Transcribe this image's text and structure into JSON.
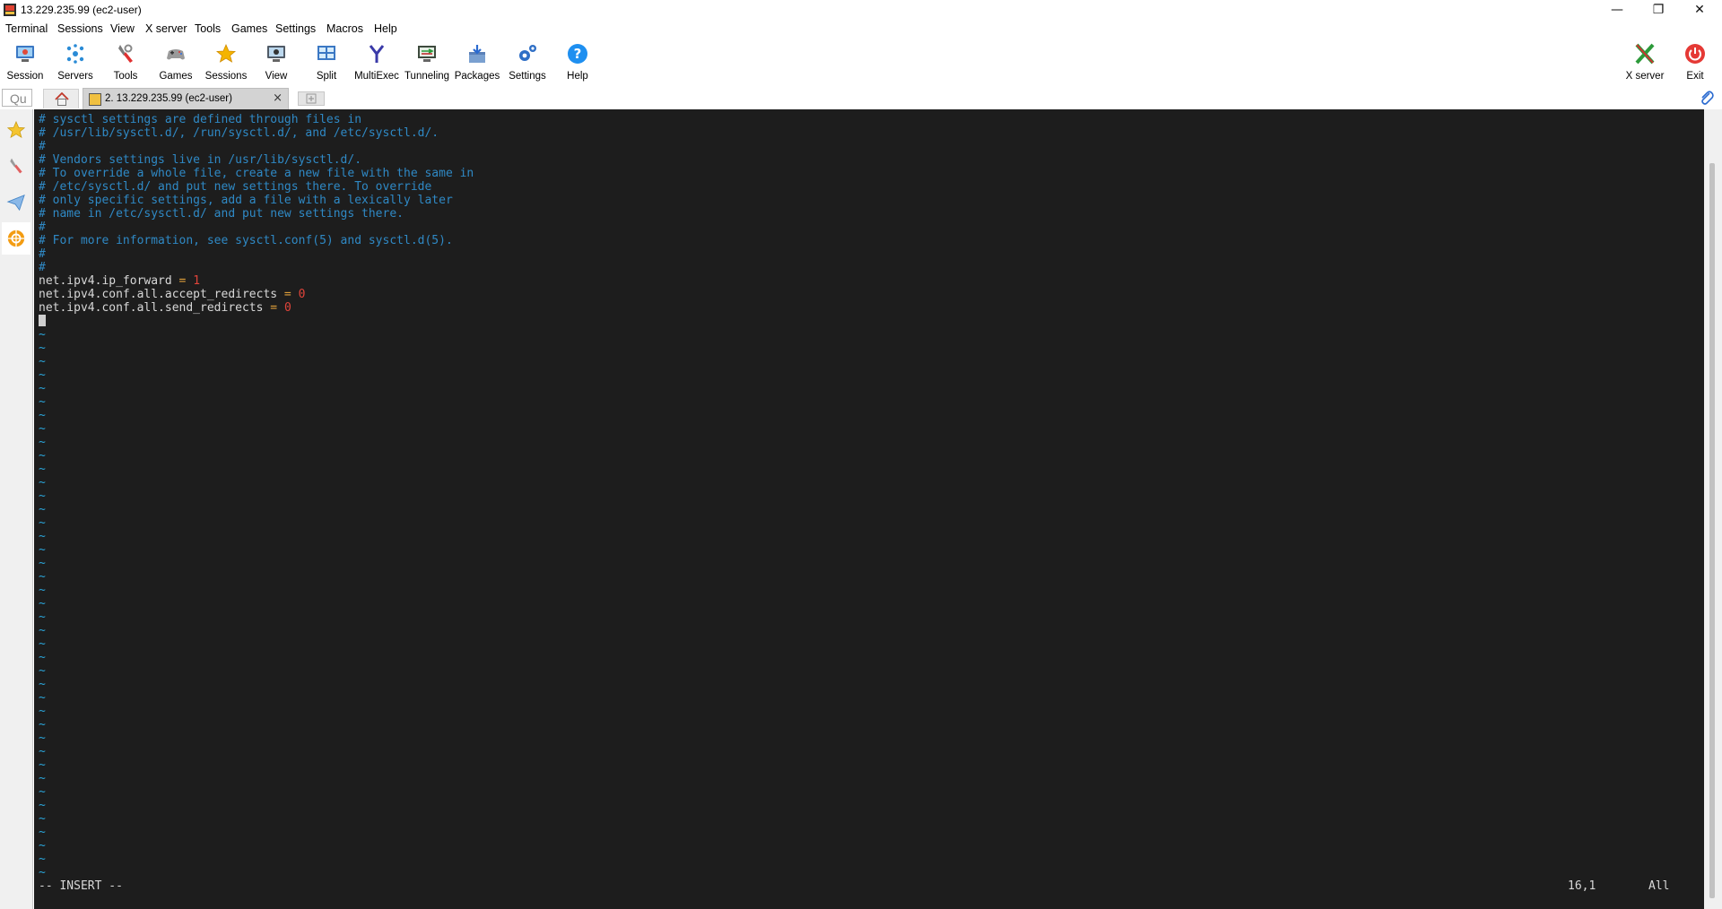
{
  "window": {
    "title": "13.229.235.99 (ec2-user)",
    "minimize_glyph": "—",
    "restore_glyph": "❐",
    "close_glyph": "✕"
  },
  "menu": [
    "Terminal",
    "Sessions",
    "View",
    "X server",
    "Tools",
    "Games",
    "Settings",
    "Macros",
    "Help"
  ],
  "toolbar": {
    "buttons": [
      {
        "label": "Session",
        "icon": "session-icon"
      },
      {
        "label": "Servers",
        "icon": "servers-icon"
      },
      {
        "label": "Tools",
        "icon": "tools-icon"
      },
      {
        "label": "Games",
        "icon": "games-icon"
      },
      {
        "label": "Sessions",
        "icon": "star-icon"
      },
      {
        "label": "View",
        "icon": "view-icon"
      },
      {
        "label": "Split",
        "icon": "split-icon"
      },
      {
        "label": "MultiExec",
        "icon": "multiexec-icon"
      },
      {
        "label": "Tunneling",
        "icon": "tunneling-icon"
      },
      {
        "label": "Packages",
        "icon": "packages-icon"
      },
      {
        "label": "Settings",
        "icon": "settings-icon"
      },
      {
        "label": "Help",
        "icon": "help-icon"
      }
    ],
    "right_buttons": [
      {
        "label": "X server",
        "icon": "x-server-icon"
      },
      {
        "label": "Exit",
        "icon": "power-icon"
      }
    ]
  },
  "tabs": {
    "quick_connect_placeholder": "Qu",
    "session_tab_label": "2. 13.229.235.99 (ec2-user)",
    "close_glyph": "×"
  },
  "sidebar": [
    "favorites-star-icon",
    "tools-icon",
    "sftp-icon",
    "macros-icon"
  ],
  "terminal": {
    "comment_lines": [
      "# sysctl settings are defined through files in",
      "# /usr/lib/sysctl.d/, /run/sysctl.d/, and /etc/sysctl.d/.",
      "#",
      "# Vendors settings live in /usr/lib/sysctl.d/.",
      "# To override a whole file, create a new file with the same in",
      "# /etc/sysctl.d/ and put new settings there. To override",
      "# only specific settings, add a file with a lexically later",
      "# name in /etc/sysctl.d/ and put new settings there.",
      "#",
      "# For more information, see sysctl.conf(5) and sysctl.d(5).",
      "#",
      "#"
    ],
    "settings": [
      {
        "key": "net.ipv4.ip_forward",
        "op": " = ",
        "value": "1"
      },
      {
        "key": "net.ipv4.conf.all.accept_redirects",
        "op": " = ",
        "value": "0"
      },
      {
        "key": "net.ipv4.conf.all.send_redirects",
        "op": " = ",
        "value": "0"
      }
    ],
    "empty_line_marker": "~",
    "empty_line_count": 41,
    "mode": "-- INSERT --",
    "position": "16,1",
    "scroll": "All"
  }
}
